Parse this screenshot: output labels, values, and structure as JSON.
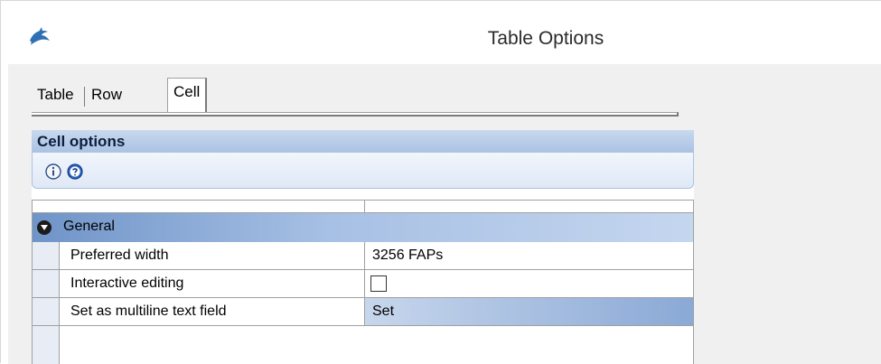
{
  "window": {
    "title": "Table Options",
    "app_icon": "dolphin-icon"
  },
  "tabs": [
    {
      "label": "Table",
      "active": false
    },
    {
      "label": "Row",
      "active": false
    },
    {
      "label": "Cell",
      "active": true
    }
  ],
  "panel": {
    "header": "Cell options",
    "toolbar": [
      {
        "icon": "info-icon"
      },
      {
        "icon": "help-icon"
      }
    ]
  },
  "grid": {
    "category": {
      "label": "General",
      "expanded": true
    },
    "properties": [
      {
        "name": "Preferred width",
        "value": "3256 FAPs",
        "type": "text"
      },
      {
        "name": "Interactive editing",
        "value": "",
        "type": "checkbox",
        "checked": false
      },
      {
        "name": "Set as multiline text field",
        "value": "Set",
        "type": "text",
        "selected": true
      }
    ]
  },
  "colors": {
    "header_bg": "#a9c2e3",
    "category_bg": "#6f94c8",
    "selected_bg": "#8aa9d6"
  }
}
